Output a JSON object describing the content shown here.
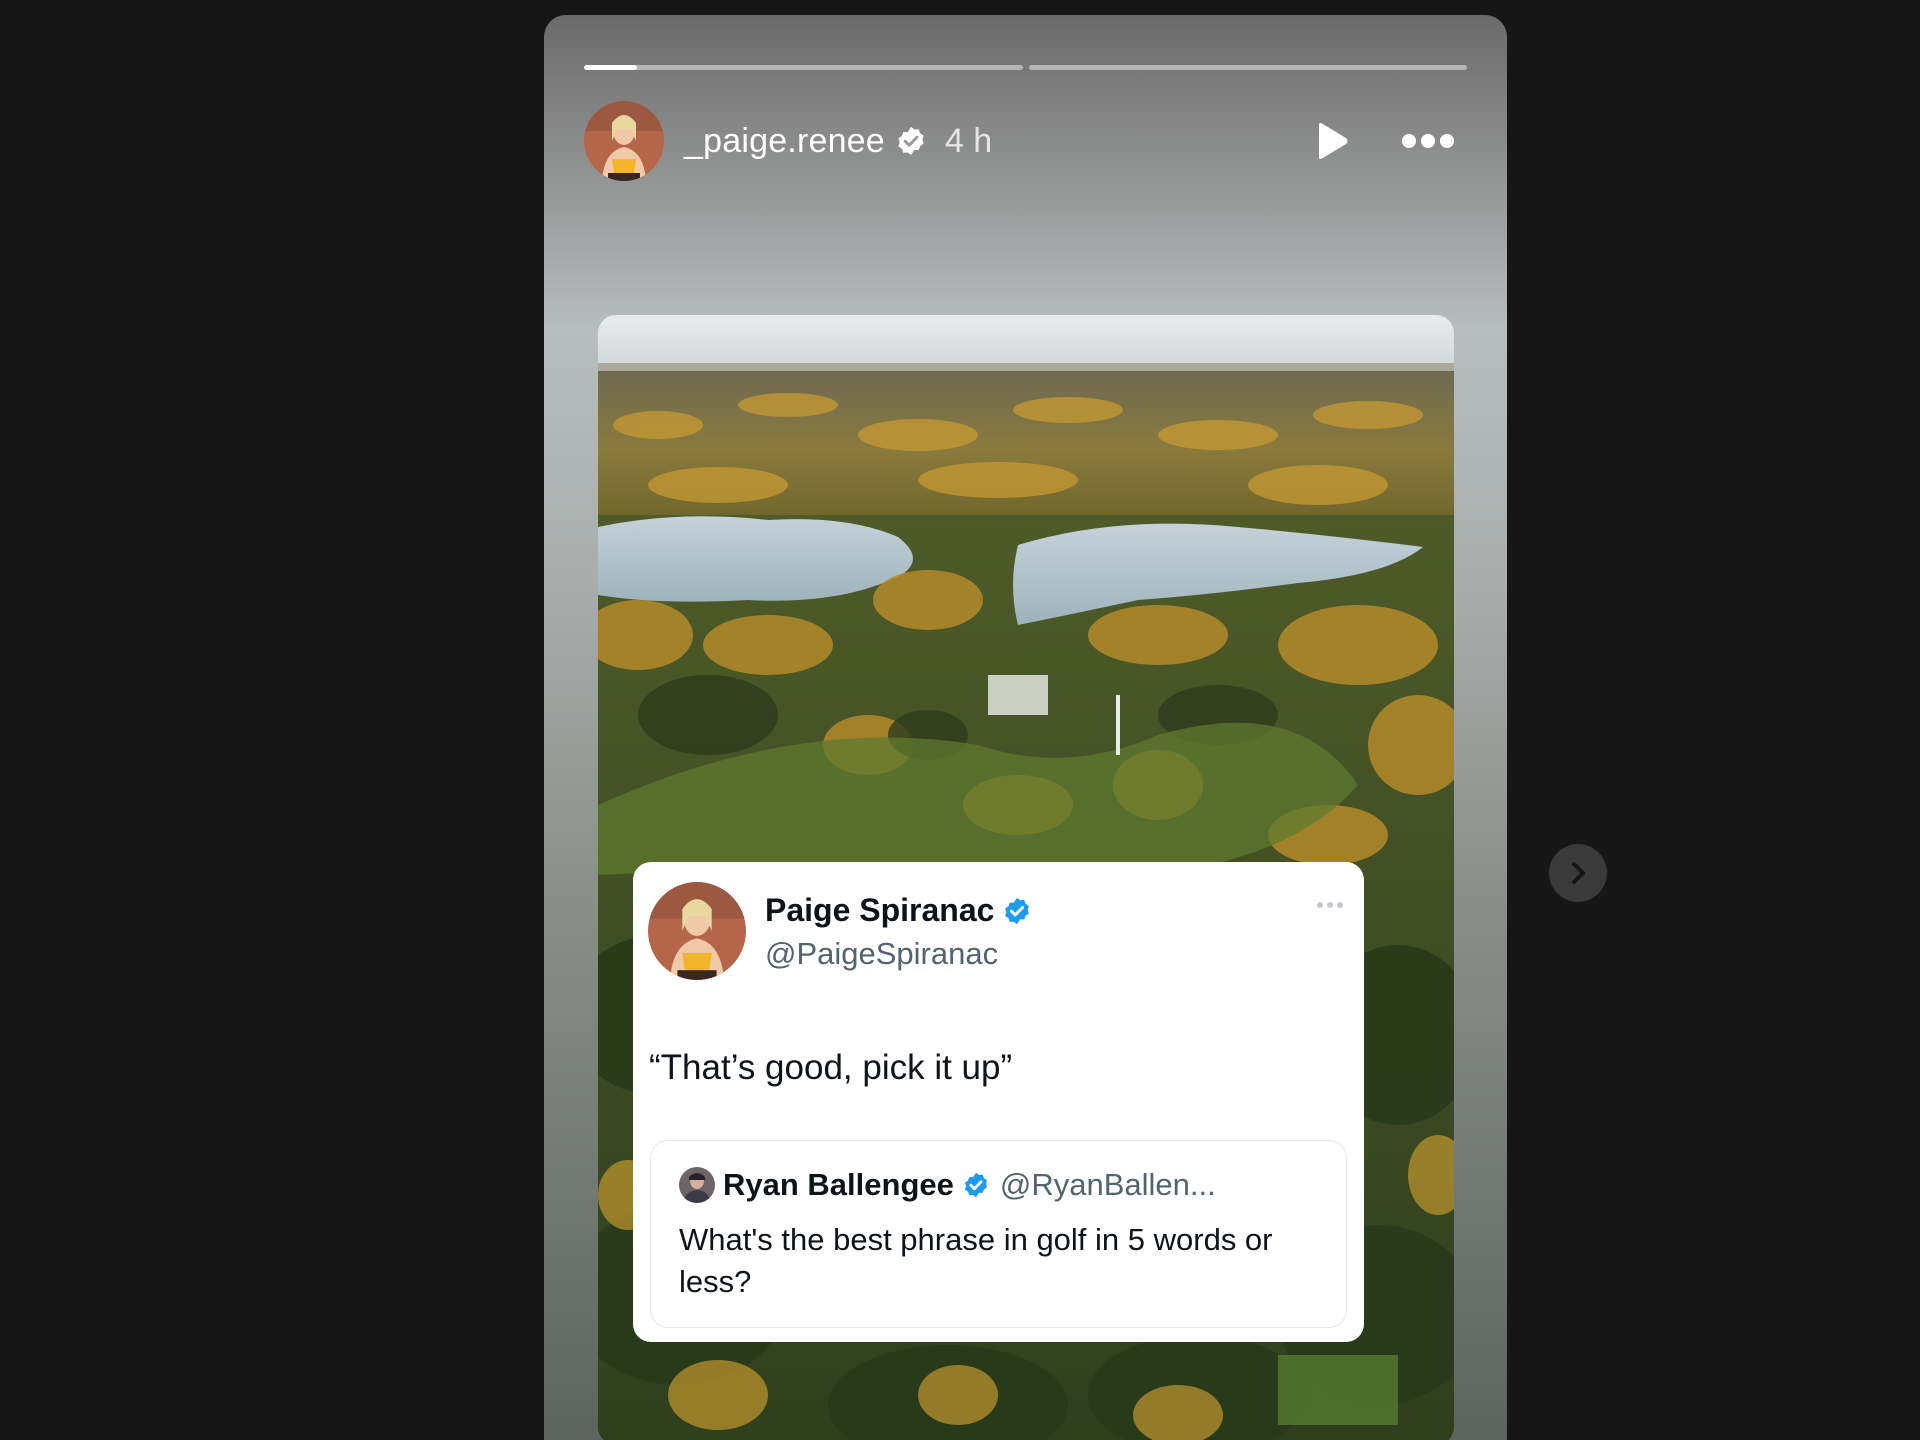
{
  "progress": {
    "segments": 2,
    "current_fill": 0.12
  },
  "header": {
    "username": "_paige.renee",
    "time": "4 h",
    "verified": true,
    "play_icon": "play-icon",
    "more_icon": "more-options-icon"
  },
  "tweet": {
    "name": "Paige Spiranac",
    "handle": "@PaigeSpiranac",
    "text": "“That’s good, pick it up”",
    "badge_color": "#1d9bf0",
    "quote": {
      "name": "Ryan Ballengee",
      "handle": "@RyanBallen...",
      "text": "What's the best phrase in golf in 5 words or less?"
    }
  },
  "navigation": {
    "next_icon": "chevron-right-icon"
  },
  "colors": {
    "background": "#161616",
    "accent": "#1d9bf0"
  }
}
